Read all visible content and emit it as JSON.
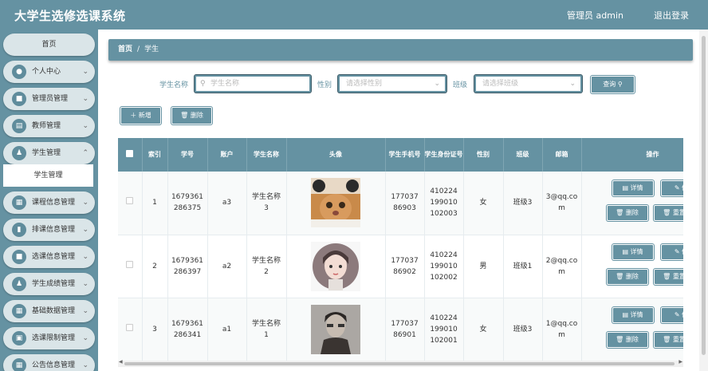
{
  "app": {
    "title": "大学生选修选课系统",
    "user": "管理员 admin",
    "logout": "退出登录"
  },
  "sidebar": {
    "home": "首页",
    "items": [
      {
        "label": "个人中心",
        "icon": "person-icon"
      },
      {
        "label": "管理员管理",
        "icon": "briefcase-icon"
      },
      {
        "label": "教师管理",
        "icon": "id-card-icon"
      },
      {
        "label": "学生管理",
        "icon": "user-group-icon"
      },
      {
        "label": "课程信息管理",
        "icon": "grid-icon"
      },
      {
        "label": "排课信息管理",
        "icon": "chart-icon"
      },
      {
        "label": "选课信息管理",
        "icon": "briefcase-icon"
      },
      {
        "label": "学生成绩管理",
        "icon": "user-group-icon"
      },
      {
        "label": "基础数据管理",
        "icon": "grid-icon"
      },
      {
        "label": "选课限制管理",
        "icon": "clipboard-icon"
      },
      {
        "label": "公告信息管理",
        "icon": "grid-icon"
      }
    ],
    "active_sub": "学生管理"
  },
  "breadcrumb": {
    "home": "首页",
    "separator": "/",
    "current": "学生"
  },
  "search": {
    "name_label": "学生名称",
    "name_placeholder": "学生名称",
    "gender_label": "性别",
    "gender_placeholder": "请选择性别",
    "class_label": "班级",
    "class_placeholder": "请选择班级",
    "query_button": "查询"
  },
  "actions": {
    "add": "新增",
    "delete": "删除"
  },
  "table": {
    "headers": [
      "索引",
      "学号",
      "账户",
      "学生名称",
      "头像",
      "学生手机号",
      "学生身份证号",
      "性别",
      "班级",
      "邮箱",
      "操作"
    ],
    "rows": [
      {
        "index": "1",
        "student_no": "1679361286375",
        "account": "a3",
        "name": "学生名称3",
        "avatar": "cat-avatar",
        "phone": "17703786903",
        "id_card": "410224199010102003",
        "gender": "女",
        "class": "班级3",
        "email": "3@qq.com"
      },
      {
        "index": "2",
        "student_no": "1679361286397",
        "account": "a2",
        "name": "学生名称2",
        "avatar": "girl-avatar",
        "phone": "17703786902",
        "id_card": "410224199010102002",
        "gender": "男",
        "class": "班级1",
        "email": "2@qq.com"
      },
      {
        "index": "3",
        "student_no": "1679361286341",
        "account": "a1",
        "name": "学生名称1",
        "avatar": "boy-avatar",
        "phone": "17703786901",
        "id_card": "410224199010102001",
        "gender": "女",
        "class": "班级3",
        "email": "1@qq.com"
      }
    ],
    "row_actions": {
      "detail": "详情",
      "edit": "修",
      "delete": "删除",
      "reset": "重置"
    }
  },
  "colors": {
    "primary": "#6592a2",
    "nav_bg": "#dae5e8"
  }
}
